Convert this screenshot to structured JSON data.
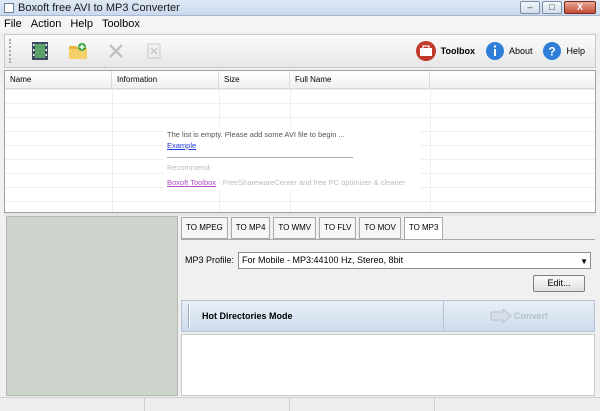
{
  "window": {
    "title": "Boxoft free AVI to MP3 Converter",
    "buttons": [
      "–",
      "□",
      "X"
    ]
  },
  "menu": [
    {
      "label": "File"
    },
    {
      "label": "Action"
    },
    {
      "label": "Help"
    },
    {
      "label": "Toolbox"
    }
  ],
  "toolbar": {
    "toolbox_label": "Toolbox",
    "about_label": "About",
    "help_label": "Help"
  },
  "file_list": {
    "columns": [
      "Name",
      "Information",
      "Size",
      "Full Name"
    ],
    "empty_message": "The list is empty. Please add some AVI file to begin ...",
    "example_link": "Example",
    "recommend_label": "Recommend:",
    "toolbox_link": "Boxoft Toolbox",
    "recommend_text": " - FreeSharewareCenter and free PC optimizer & cleaner"
  },
  "format_tabs": [
    "TO MPEG",
    "TO MP4",
    "TO WMV",
    "TO FLV",
    "TO MOV",
    "TO MP3"
  ],
  "active_tab": "TO MP3",
  "profile": {
    "label": "MP3 Profile:",
    "value": "For Mobile - MP3:44100 Hz, Stereo, 8bit"
  },
  "edit_button": "Edit...",
  "hot_dir": {
    "label": "Hot Directories Mode",
    "convert_label": "Convert"
  }
}
